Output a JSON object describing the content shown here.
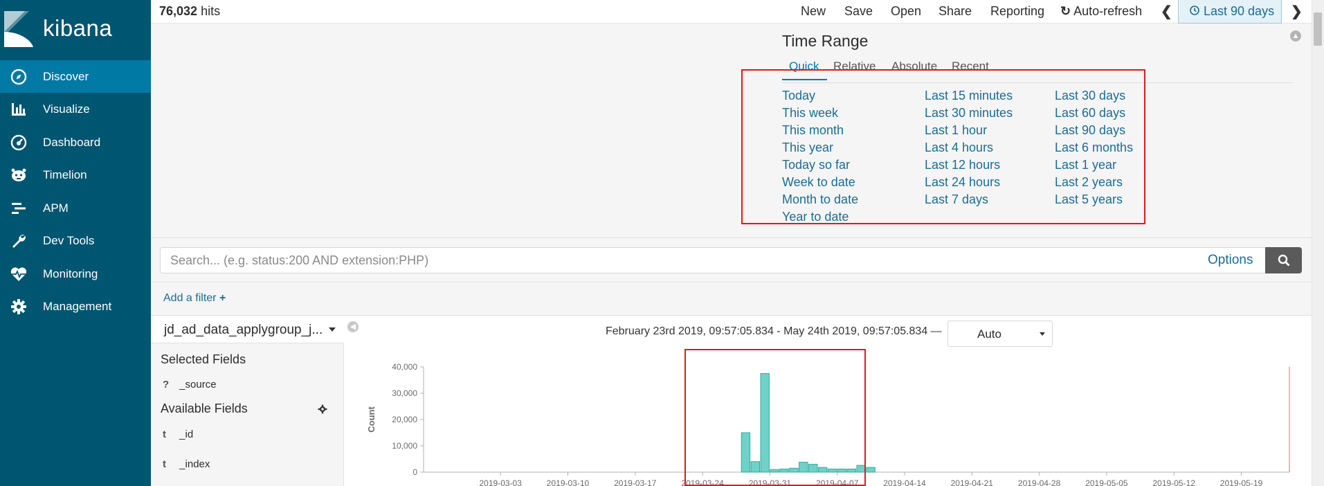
{
  "sidebar": {
    "brand": "kibana",
    "items": [
      {
        "label": "Discover",
        "icon": "compass-icon",
        "active": true
      },
      {
        "label": "Visualize",
        "icon": "bar-chart-icon"
      },
      {
        "label": "Dashboard",
        "icon": "dashboard-gauge-icon"
      },
      {
        "label": "Timelion",
        "icon": "timelion-icon"
      },
      {
        "label": "APM",
        "icon": "apm-icon"
      },
      {
        "label": "Dev Tools",
        "icon": "wrench-icon"
      },
      {
        "label": "Monitoring",
        "icon": "heartbeat-icon"
      },
      {
        "label": "Management",
        "icon": "gear-icon"
      }
    ]
  },
  "topbar": {
    "hits_count": "76,032",
    "hits_label": "hits",
    "menu": [
      "New",
      "Save",
      "Open",
      "Share",
      "Reporting",
      "Auto-refresh"
    ],
    "time_picker": "Last 90 days"
  },
  "time_range": {
    "title": "Time Range",
    "tabs": [
      "Quick",
      "Relative",
      "Absolute",
      "Recent"
    ],
    "active_tab": "Quick",
    "quick_columns": [
      [
        "Today",
        "This week",
        "This month",
        "This year",
        "Today so far",
        "Week to date",
        "Month to date",
        "Year to date"
      ],
      [
        "Last 15 minutes",
        "Last 30 minutes",
        "Last 1 hour",
        "Last 4 hours",
        "Last 12 hours",
        "Last 24 hours",
        "Last 7 days"
      ],
      [
        "Last 30 days",
        "Last 60 days",
        "Last 90 days",
        "Last 6 months",
        "Last 1 year",
        "Last 2 years",
        "Last 5 years"
      ]
    ]
  },
  "search": {
    "placeholder": "Search... (e.g. status:200 AND extension:PHP)",
    "options_label": "Options"
  },
  "filters": {
    "add_label": "Add a filter"
  },
  "fields": {
    "index_pattern": "jd_ad_data_applygroup_j...",
    "selected_title": "Selected Fields",
    "selected": [
      {
        "type": "?",
        "name": "_source"
      }
    ],
    "available_title": "Available Fields",
    "available": [
      {
        "type": "t",
        "name": "_id"
      },
      {
        "type": "t",
        "name": "_index"
      }
    ]
  },
  "histogram": {
    "range_text": "February 23rd 2019, 09:57:05.834 - May 24th 2019, 09:57:05.834 —",
    "interval": "Auto"
  },
  "colors": {
    "sidebar_bg": "#005571",
    "sidebar_active": "#0079a5",
    "link": "#1b6c94",
    "bar_fill": "#6fd1c7",
    "bar_stroke": "#3aa89c",
    "highlight_box": "#e0191f"
  },
  "chart_data": {
    "type": "bar",
    "ylabel": "Count",
    "ylim": [
      0,
      40000
    ],
    "yticks": [
      0,
      10000,
      20000,
      30000,
      40000
    ],
    "ytick_labels": [
      "0",
      "10,000",
      "20,000",
      "30,000",
      "40,000"
    ],
    "xtick_labels": [
      "2019-03-03",
      "2019-03-10",
      "2019-03-17",
      "2019-03-24",
      "2019-03-31",
      "2019-04-07",
      "2019-04-14",
      "2019-04-21",
      "2019-04-28",
      "2019-05-05",
      "2019-05-12",
      "2019-05-19"
    ],
    "x_start": "2019-02-23",
    "x_end": "2019-05-24",
    "x": [
      "2019-03-28",
      "2019-03-29",
      "2019-03-30",
      "2019-03-31",
      "2019-04-01",
      "2019-04-02",
      "2019-04-03",
      "2019-04-04",
      "2019-04-05",
      "2019-04-06",
      "2019-04-07",
      "2019-04-08",
      "2019-04-09",
      "2019-04-10"
    ],
    "values": [
      15000,
      4000,
      37500,
      1000,
      1200,
      1500,
      3800,
      3000,
      1800,
      1200,
      1200,
      1200,
      2600,
      1800
    ]
  }
}
